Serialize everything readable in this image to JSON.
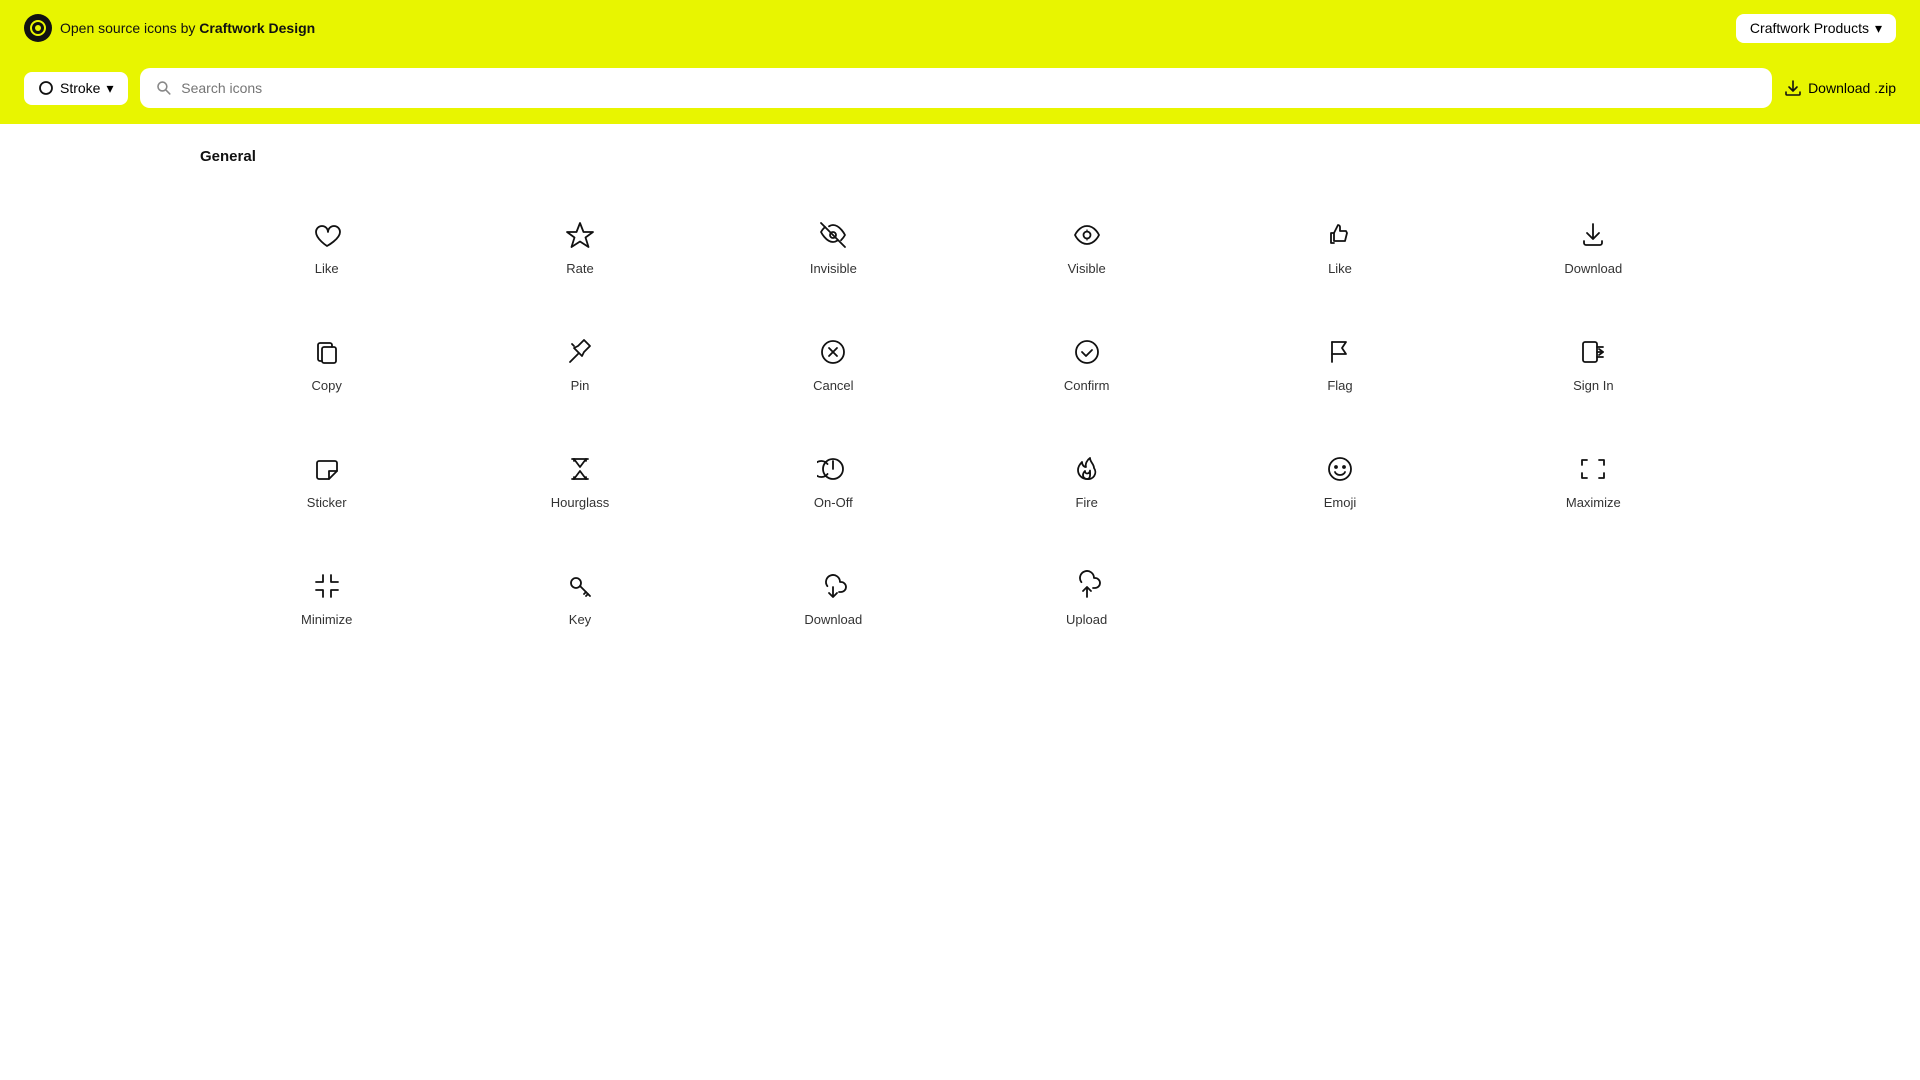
{
  "topbar": {
    "logo_alt": "Craftwork Logo",
    "open_source_text": "Open source icons by ",
    "brand_name": "Craftwork Design",
    "products_button": "Craftwork Products",
    "chevron": "▾"
  },
  "searchbar": {
    "stroke_label": "Stroke",
    "stroke_chevron": "▾",
    "search_placeholder": "Search icons",
    "download_zip_label": "Download .zip"
  },
  "section": {
    "label": "General"
  },
  "icons": [
    {
      "name": "Like",
      "id": "like-heart"
    },
    {
      "name": "Rate",
      "id": "rate-star"
    },
    {
      "name": "Invisible",
      "id": "invisible-eye"
    },
    {
      "name": "Visible",
      "id": "visible-eye"
    },
    {
      "name": "Like",
      "id": "like-thumb"
    },
    {
      "name": "Download",
      "id": "download-arrow"
    },
    {
      "name": "Copy",
      "id": "copy-doc"
    },
    {
      "name": "Pin",
      "id": "pin"
    },
    {
      "name": "Cancel",
      "id": "cancel-circle"
    },
    {
      "name": "Confirm",
      "id": "confirm-check"
    },
    {
      "name": "Flag",
      "id": "flag"
    },
    {
      "name": "Sign In",
      "id": "sign-in"
    },
    {
      "name": "Sticker",
      "id": "sticker"
    },
    {
      "name": "Hourglass",
      "id": "hourglass"
    },
    {
      "name": "On-Off",
      "id": "on-off"
    },
    {
      "name": "Fire",
      "id": "fire"
    },
    {
      "name": "Emoji",
      "id": "emoji"
    },
    {
      "name": "Maximize",
      "id": "maximize"
    },
    {
      "name": "Minimize",
      "id": "minimize"
    },
    {
      "name": "Key",
      "id": "key"
    },
    {
      "name": "Download",
      "id": "download2"
    },
    {
      "name": "Upload",
      "id": "upload"
    }
  ]
}
